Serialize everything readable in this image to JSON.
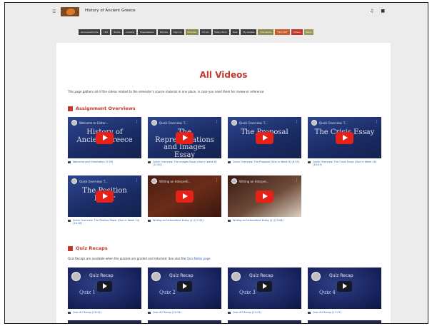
{
  "header": {
    "course_title": "History of Ancient Greece",
    "menu_icon": "menu-icon",
    "icons": [
      "bell-icon",
      "chat-icon"
    ]
  },
  "nav": [
    {
      "label": "Announcements",
      "style": "dark"
    },
    {
      "label": "HRL",
      "style": "dark"
    },
    {
      "label": "Books",
      "style": "dark"
    },
    {
      "label": "Grading",
      "style": "dark"
    },
    {
      "label": "Expectations",
      "style": "dark"
    },
    {
      "label": "Policies",
      "style": "dark"
    },
    {
      "label": "Sign Up",
      "style": "dark"
    },
    {
      "label": "Modules",
      "style": "olive"
    },
    {
      "label": "Forum",
      "style": "dark"
    },
    {
      "label": "Essay Work",
      "style": "dark"
    },
    {
      "label": "Quiz",
      "style": "dark"
    },
    {
      "label": "My Grades",
      "style": "dark"
    },
    {
      "label": "Discussion",
      "style": "olive"
    },
    {
      "label": "HRL/UNIT",
      "style": "orange"
    },
    {
      "label": "Videos",
      "style": "red"
    },
    {
      "label": "Store",
      "style": "olive2"
    }
  ],
  "page": {
    "title": "All Videos",
    "intro": "This page gathers all of the videos related to the semester's course material in one place, in case you need them for review or reference."
  },
  "sections": {
    "assignment": {
      "heading": "Assignment Overviews",
      "videos": [
        {
          "thumb_title": "Welcome to Histor...",
          "big": "History of Ancient Greece",
          "label": "Welcome and Orientation (7:49)",
          "style": "blue"
        },
        {
          "thumb_title": "Quick Overview: T...",
          "big": "The Representations and Images Essay",
          "label": "Quick Overview: The Images Essay (due in week 6) (11:50)",
          "style": "blue"
        },
        {
          "thumb_title": "Quick Overview: T...",
          "big": "The Proposal",
          "label": "Quick Overview: The Proposal (Due in Week 8) (6:33)",
          "style": "blue"
        },
        {
          "thumb_title": "Quick Overview: T...",
          "big": "The Crisis Essay",
          "label": "Quick Overview: The Crisis Essay (Due in Week 10) (16:03)",
          "style": "blue"
        },
        {
          "thumb_title": "Quick Overview: T...",
          "big": "The Position Paper",
          "label": "Quick Overview: The Position Paper (Due in Week 14) (14:18)",
          "style": "blue"
        },
        {
          "thumb_title": "Writing an Interpreti...",
          "big": "",
          "label": "Writing an Interpretive Essay (1) (17:43)",
          "style": "dark"
        },
        {
          "thumb_title": "Writing an Interpre...",
          "big": "",
          "label": "Writing an Interpretive Essay (2) (13:08)",
          "style": "paper"
        }
      ]
    },
    "quiz": {
      "heading": "Quiz Recaps",
      "subtext": "Quiz Recaps are available when the quizzes are graded and returned. See also the",
      "link": "Quiz Notes page",
      "videos": [
        {
          "thumb_title": "Quiz Recap",
          "sub": "Quiz 1",
          "label": "Quiz #1 Recap (18:10)"
        },
        {
          "thumb_title": "Quiz Recap",
          "sub": "Quiz 2",
          "label": "Quiz #2 Recap (20:34)"
        },
        {
          "thumb_title": "Quiz Recap",
          "sub": "Quiz 3",
          "label": "Quiz #3 Recap (13:23)"
        },
        {
          "thumb_title": "Quiz Recap",
          "sub": "Quiz 4",
          "label": "Quiz #4 Recap (17:27)"
        }
      ]
    }
  }
}
